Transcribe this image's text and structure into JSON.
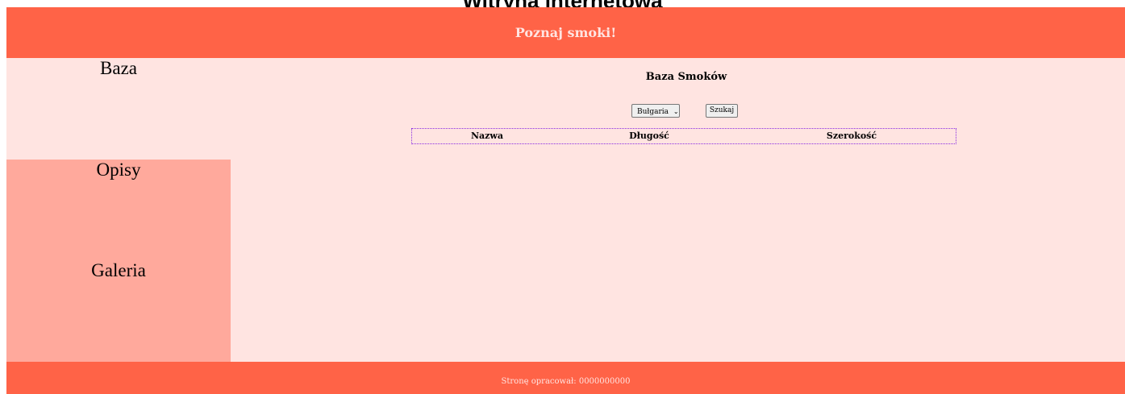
{
  "page": {
    "site_title": "Witryna internetowa"
  },
  "header": {
    "title": "Poznaj smoki!"
  },
  "nav": {
    "baza": "Baza",
    "opisy": "Opisy",
    "galeria": "Galeria"
  },
  "main": {
    "title": "Baza Smoków",
    "select": {
      "selected": "Bułgaria",
      "chevron": "⌄"
    },
    "search_label": "Szukaj",
    "table": {
      "columns": [
        "Nazwa",
        "Długość",
        "Szerokość"
      ]
    }
  },
  "footer": {
    "text": "Stronę opracował: 0000000000"
  },
  "colors": {
    "header_bg": "#ff6347",
    "panel_light": "#ffe4e1",
    "panel_dark": "#ffa99c",
    "table_border": "#8a2be2"
  }
}
